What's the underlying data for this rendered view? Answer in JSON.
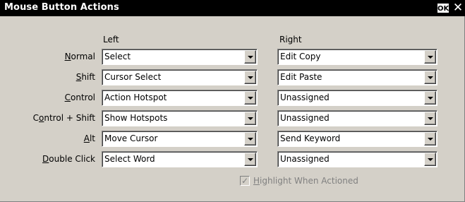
{
  "window": {
    "title": "Mouse Button Actions",
    "ok_label": "OK",
    "close_label": "✕"
  },
  "columns": {
    "left": "Left",
    "right": "Right"
  },
  "rows": [
    {
      "pre": "",
      "key": "N",
      "post": "ormal",
      "left": "Select",
      "right": "Edit Copy"
    },
    {
      "pre": "",
      "key": "S",
      "post": "hift",
      "left": "Cursor Select",
      "right": "Edit Paste"
    },
    {
      "pre": "",
      "key": "C",
      "post": "ontrol",
      "left": "Action Hotspot",
      "right": "Unassigned"
    },
    {
      "pre": "C",
      "key": "o",
      "post": "ntrol + Shift",
      "left": "Show Hotspots",
      "right": "Unassigned"
    },
    {
      "pre": "",
      "key": "A",
      "post": "lt",
      "left": "Move Cursor",
      "right": "Send Keyword"
    },
    {
      "pre": "",
      "key": "D",
      "post": "ouble Click",
      "left": "Select Word",
      "right": "Unassigned"
    }
  ],
  "highlight": {
    "key": "H",
    "rest": "ighlight When Actioned",
    "checked": true,
    "enabled": false,
    "check_glyph": "✓"
  },
  "icons": {
    "dropdown": "chevron-down-icon",
    "check": "check-icon"
  }
}
